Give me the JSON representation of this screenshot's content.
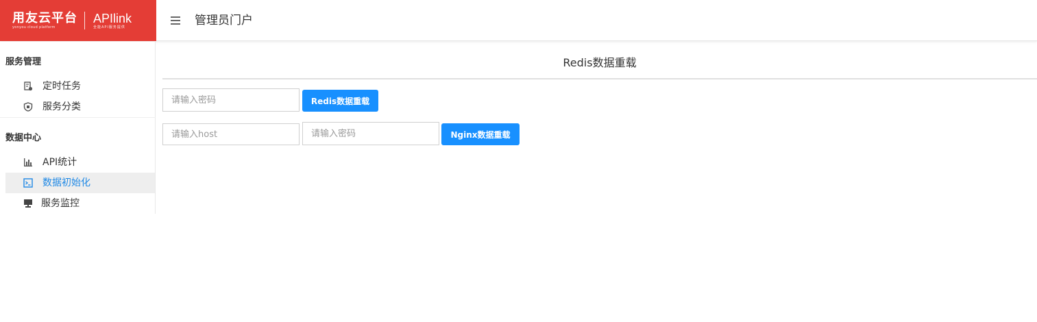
{
  "header": {
    "logo_cn": "用友云平台",
    "logo_cn_sub": "yonyou cloud platform",
    "logo_en": "APIlink",
    "logo_en_sub": "全能API服务提供",
    "menu_icon": "hamburger-menu-icon",
    "title": "管理员门户"
  },
  "sidebar": {
    "groups": [
      {
        "title": "服务管理",
        "items": [
          {
            "label": "定时任务",
            "icon": "scheduled-task-icon"
          },
          {
            "label": "服务分类",
            "icon": "shield-icon"
          }
        ]
      },
      {
        "title": "数据中心",
        "items": [
          {
            "label": "API统计",
            "icon": "bar-chart-icon"
          },
          {
            "label": "数据初始化",
            "icon": "terminal-icon",
            "active": true
          },
          {
            "label": "服务监控",
            "icon": "monitor-icon"
          }
        ]
      }
    ]
  },
  "main": {
    "title": "Redis数据重载",
    "redis": {
      "password_placeholder": "请输入密码",
      "button_label": "Redis数据重载"
    },
    "nginx": {
      "host_placeholder": "请输入host",
      "password_placeholder": "请输入密码",
      "button_label": "Nginx数据重载"
    }
  },
  "colors": {
    "brand_red": "#e43d36",
    "primary_blue": "#1890ff",
    "active_text": "#1e88e5",
    "active_bg": "#eeeeee"
  }
}
